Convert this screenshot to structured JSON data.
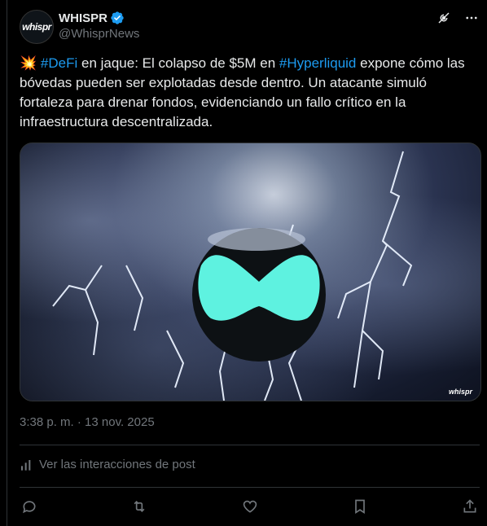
{
  "author": {
    "avatar_text": "whispr",
    "name": "WHISPR",
    "handle": "@WhisprNews"
  },
  "post": {
    "emoji": "💥",
    "tag1": "#DeFi",
    "text1": " en jaque: El colapso de $5M en ",
    "tag2": "#Hyperliquid",
    "text2": " expone cómo las bóvedas pueden ser explotadas desde dentro. Un atacante simuló fortaleza para drenar fondos, evidenciando un fallo crítico en la infraestructura descentralizada.",
    "image_watermark": "whispr",
    "timestamp": "3:38 p. m. · 13 nov. 2025"
  },
  "interactions_label": "Ver las interacciones de post",
  "colors": {
    "accent": "#1d9bf0",
    "logo": "#5ef2e0"
  }
}
